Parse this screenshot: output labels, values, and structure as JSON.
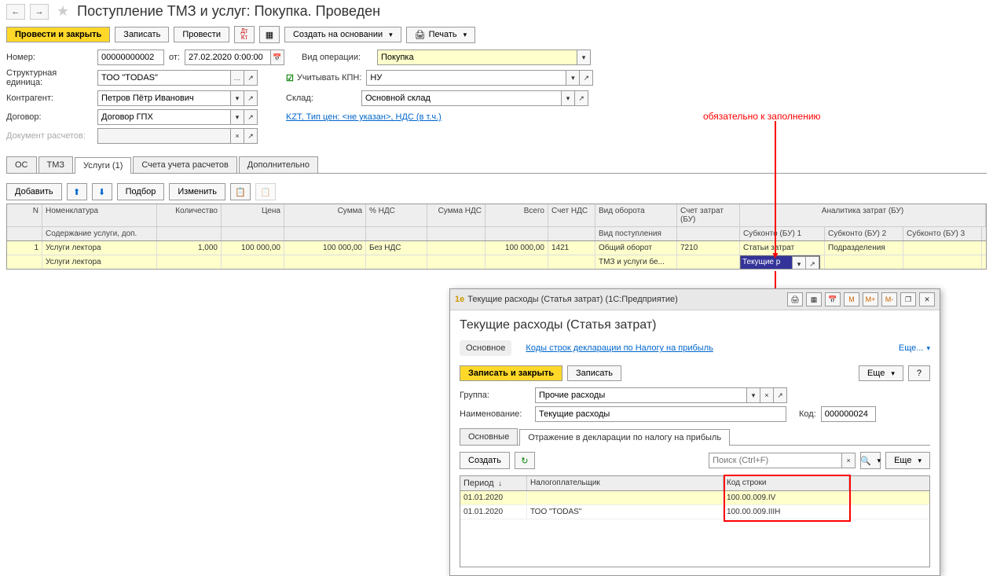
{
  "header": {
    "title": "Поступление ТМЗ и услуг: Покупка. Проведен"
  },
  "toolbar": {
    "post_close": "Провести и закрыть",
    "save": "Записать",
    "post": "Провести",
    "create_based": "Создать на основании",
    "print": "Печать"
  },
  "form": {
    "number_label": "Номер:",
    "number": "00000000002",
    "from_label": "от:",
    "date": "27.02.2020 0:00:00",
    "op_type_label": "Вид операции:",
    "op_type": "Покупка",
    "org_label": "Структурная единица:",
    "org": "ТОО \"TODAS\"",
    "kpn_label": "Учитывать КПН:",
    "kpn_val": "НУ",
    "contragent_label": "Контрагент:",
    "contragent": "Петров Пётр Иванович",
    "sklad_label": "Склад:",
    "sklad": "Основной склад",
    "dogovor_label": "Договор:",
    "dogovor": "Договор ГПХ",
    "currency_link": "KZT, Тип цен: <не указан>, НДС (в т.ч.)",
    "doc_calc_label": "Документ расчетов:"
  },
  "tabs": {
    "os": "ОС",
    "tmz": "ТМЗ",
    "services": "Услуги (1)",
    "accounts": "Счета учета расчетов",
    "extra": "Дополнительно"
  },
  "tabletb": {
    "add": "Добавить",
    "select": "Подбор",
    "change": "Изменить"
  },
  "grid": {
    "h1": {
      "n": "N",
      "nom": "Номенклатура",
      "qty": "Количество",
      "price": "Цена",
      "sum": "Сумма",
      "nds": "% НДС",
      "sumnds": "Сумма НДС",
      "total": "Всего",
      "acctnds": "Счет НДС",
      "vid": "Вид оборота",
      "acctz": "Счет затрат (БУ)",
      "anal": "Аналитика затрат (БУ)"
    },
    "h2": {
      "nom": "Содержание услуги, доп.",
      "vid": "Вид поступления",
      "sub1": "Субконто (БУ) 1",
      "sub2": "Субконто (БУ) 2",
      "sub3": "Субконто (БУ) 3"
    },
    "r1": {
      "n": "1",
      "nom": "Услуги лектора",
      "qty": "1,000",
      "price": "100 000,00",
      "sum": "100 000,00",
      "nds": "Без НДС",
      "total": "100 000,00",
      "acctnds": "1421",
      "vid": "Общий оборот",
      "acctz": "7210",
      "sub1": "Статьи затрат",
      "sub2": "Подразделения"
    },
    "r2": {
      "nom": "Услуги лектора",
      "vid": "ТМЗ и услуги бе...",
      "sub1_edit": "Текущие р"
    }
  },
  "annotation": {
    "text": "обязательно к заполнению"
  },
  "dialog": {
    "title": "Текущие расходы (Статья затрат)  (1С:Предприятие)",
    "heading": "Текущие расходы (Статья затрат)",
    "nav": {
      "main": "Основное",
      "codes": "Коды строк декларации по Налогу на прибыль",
      "more": "Еще..."
    },
    "tb": {
      "savec": "Записать и закрыть",
      "save": "Записать",
      "more": "Еще",
      "help": "?"
    },
    "group_label": "Группа:",
    "group": "Прочие расходы",
    "name_label": "Наименование:",
    "name": "Текущие расходы",
    "code_label": "Код:",
    "code": "000000024",
    "tabs": {
      "main": "Основные",
      "decl": "Отражение в декларации по налогу на прибыль"
    },
    "subtb": {
      "create": "Создать",
      "search_ph": "Поиск (Ctrl+F)",
      "more": "Еще"
    },
    "subgrid": {
      "h": {
        "period": "Период",
        "np": "Налогоплательщик",
        "kod": "Код строки"
      },
      "rows": [
        {
          "period": "01.01.2020",
          "np": "",
          "kod": "100.00.009.IV"
        },
        {
          "period": "01.01.2020",
          "np": "ТОО \"TODAS\"",
          "kod": "100.00.009.IIIH"
        }
      ]
    },
    "m": "M",
    "mp": "M+",
    "mm": "M-"
  }
}
